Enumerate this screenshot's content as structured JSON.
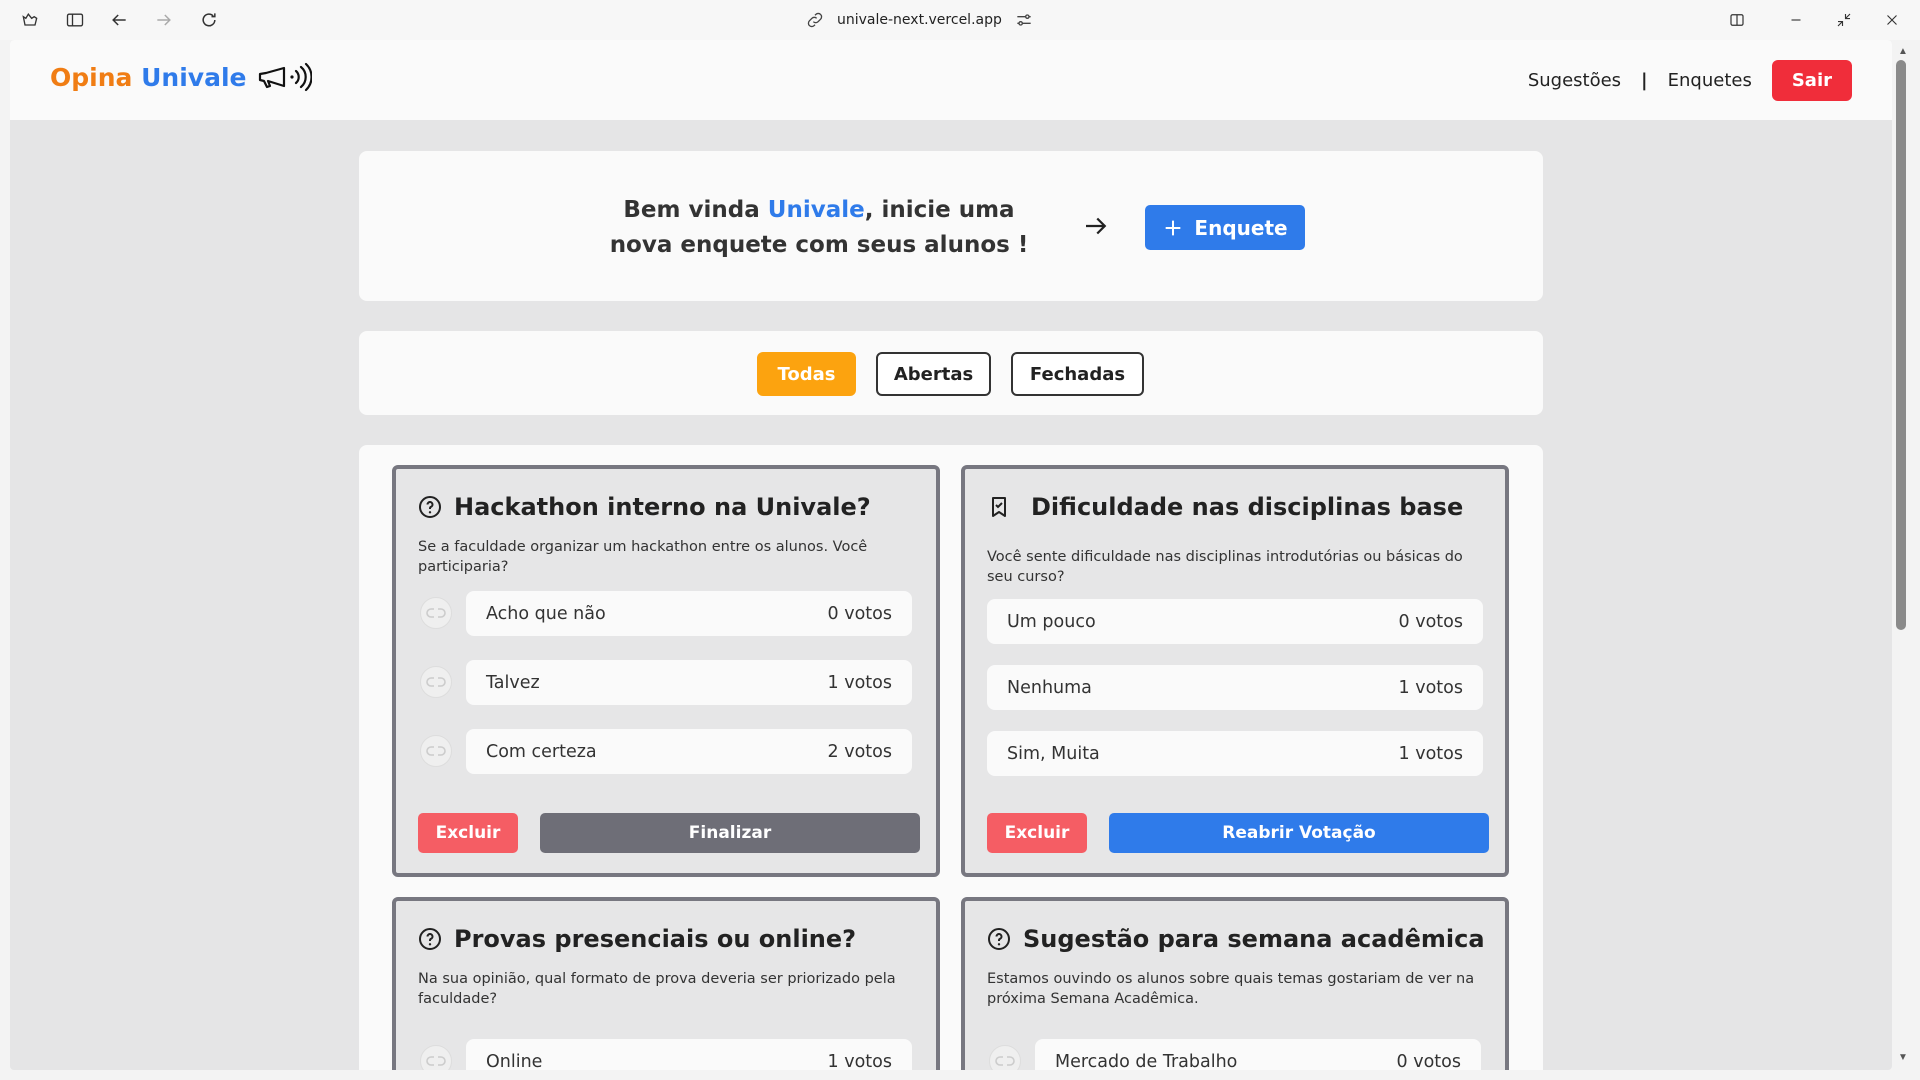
{
  "browser": {
    "url": "univale-next.vercel.app"
  },
  "header": {
    "logo_part1": "Opina",
    "logo_part2": "Univale",
    "nav_suggestions": "Sugestões",
    "nav_separator": "|",
    "nav_polls": "Enquetes",
    "logout": "Sair"
  },
  "welcome": {
    "text_before": "Bem vinda ",
    "highlight": "Univale",
    "text_after": ", inicie uma nova enquete com seus alunos !",
    "new_poll_button": "Enquete"
  },
  "filters": {
    "all": "Todas",
    "open": "Abertas",
    "closed": "Fechadas",
    "active": "all"
  },
  "polls": [
    {
      "title": "Hackathon interno na Univale?",
      "description": "Se a faculdade organizar um hackathon entre os alunos. Você participaria?",
      "status": "open",
      "icon": "question-circle-icon",
      "options": [
        {
          "label": "Acho que não",
          "votes": "0 votos"
        },
        {
          "label": "Talvez",
          "votes": "1 votos"
        },
        {
          "label": "Com certeza",
          "votes": "2 votos"
        }
      ],
      "delete_label": "Excluir",
      "action_label": "Finalizar"
    },
    {
      "title": "Dificuldade nas disciplinas base",
      "description": "Você sente dificuldade nas disciplinas introdutórias ou básicas do seu curso?",
      "status": "closed",
      "icon": "bookmark-icon",
      "options": [
        {
          "label": "Um pouco",
          "votes": "0 votos"
        },
        {
          "label": "Nenhuma",
          "votes": "1 votos"
        },
        {
          "label": "Sim, Muita",
          "votes": "1 votos"
        }
      ],
      "delete_label": "Excluir",
      "action_label": "Reabrir Votação"
    },
    {
      "title": "Provas presenciais ou online?",
      "description": "Na sua opinião, qual formato de prova deveria ser priorizado pela faculdade?",
      "status": "open",
      "icon": "question-circle-icon",
      "options": [
        {
          "label": "Online",
          "votes": "1 votos"
        }
      ]
    },
    {
      "title": "Sugestão para semana acadêmica",
      "description": "Estamos ouvindo os alunos sobre quais temas gostariam de ver na próxima Semana Acadêmica.",
      "status": "open",
      "icon": "question-circle-icon",
      "options": [
        {
          "label": "Mercado de Trabalho",
          "votes": "0 votos"
        }
      ]
    }
  ],
  "colors": {
    "brand_orange": "#f07d14",
    "brand_blue": "#2f7bea",
    "danger": "#f02d3a",
    "filter_active": "#fca30f"
  }
}
